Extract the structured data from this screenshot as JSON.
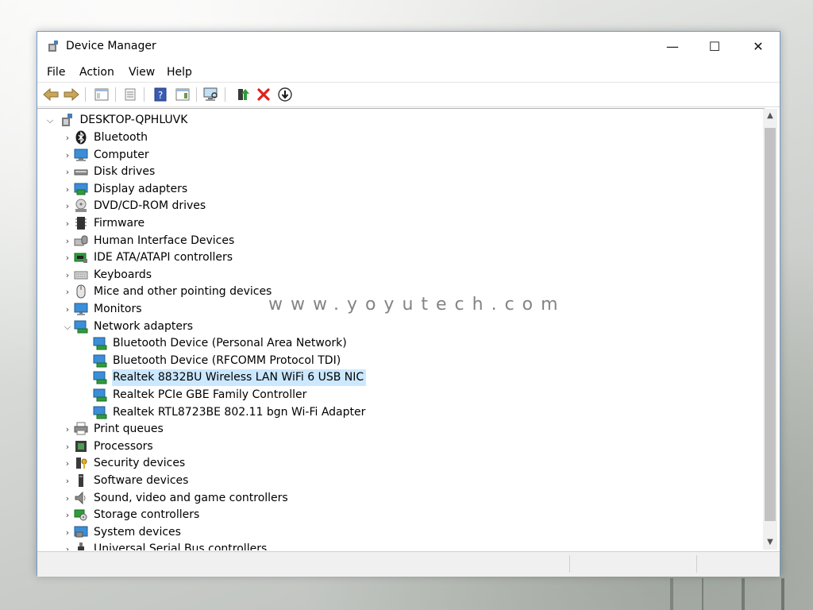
{
  "window": {
    "title": "Device Manager",
    "controls": {
      "minimize": "—",
      "maximize": "☐",
      "close": "✕"
    }
  },
  "menu": {
    "items": [
      "File",
      "Action",
      "View",
      "Help"
    ]
  },
  "toolbar": {
    "buttons": [
      "back-arrow-icon",
      "forward-arrow-icon",
      "show-hide-console-tree-icon",
      "properties-icon",
      "help-icon",
      "action-pane-icon",
      "scan-hardware-icon",
      "update-driver-icon",
      "uninstall-device-icon",
      "disable-device-icon"
    ]
  },
  "tree": {
    "root": "DESKTOP-QPHLUVK",
    "categories_before": [
      "Bluetooth",
      "Computer",
      "Disk drives",
      "Display adapters",
      "DVD/CD-ROM drives",
      "Firmware",
      "Human Interface Devices",
      "IDE ATA/ATAPI controllers",
      "Keyboards",
      "Mice and other pointing devices",
      "Monitors"
    ],
    "expanded_category": "Network adapters",
    "network_children": [
      "Bluetooth Device (Personal Area Network)",
      "Bluetooth Device (RFCOMM Protocol TDI)",
      "Realtek 8832BU Wireless LAN WiFi 6 USB NIC",
      "Realtek PCIe GBE Family Controller",
      "Realtek RTL8723BE 802.11 bgn Wi-Fi Adapter"
    ],
    "selected": "Realtek 8832BU Wireless LAN WiFi 6 USB NIC",
    "categories_after": [
      "Print queues",
      "Processors",
      "Security devices",
      "Software devices",
      "Sound, video and game controllers",
      "Storage controllers",
      "System devices",
      "Universal Serial Bus controllers"
    ]
  },
  "watermark": "www.yoyutech.com",
  "colors": {
    "selection": "#cce8ff",
    "window_border": "#6d9cc7",
    "uninstall_red": "#e0201b"
  }
}
